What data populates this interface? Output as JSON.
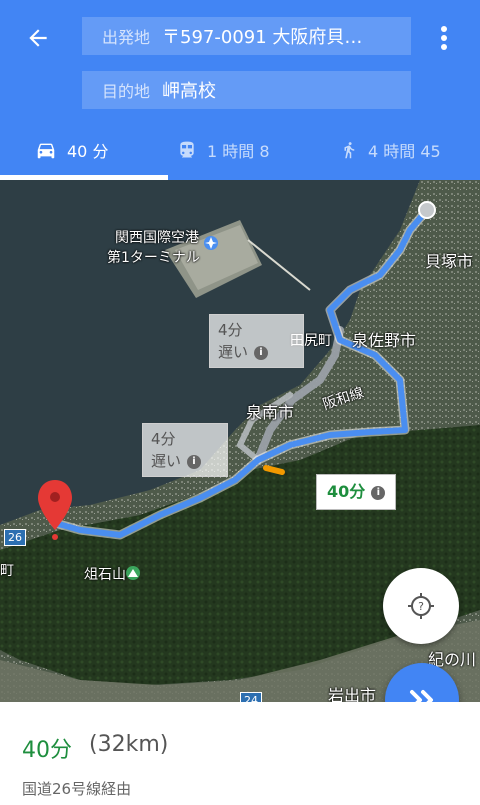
{
  "header": {
    "back_icon": "arrow-back-icon",
    "more_icon": "more-vert-icon",
    "origin": {
      "label": "出発地",
      "value": "〒597-0091 大阪府貝…"
    },
    "destination": {
      "label": "目的地",
      "value": "岬高校"
    },
    "colors": {
      "bar": "#4285f4",
      "text": "#ffffff"
    }
  },
  "tabs": [
    {
      "icon": "car-icon",
      "label": "40 分",
      "active": true
    },
    {
      "icon": "train-icon",
      "label": "1 時間 8",
      "active": false
    },
    {
      "icon": "walk-icon",
      "label": "4 時間 45",
      "active": false
    }
  ],
  "map": {
    "labels": {
      "airport_line1": "関西国際空港",
      "airport_line2": "第1ターミナル",
      "kaizuka": "貝塚市",
      "tajiri": "田尻町",
      "izumisano": "泉佐野市",
      "sennan": "泉南市",
      "hanwa": "阪和線",
      "sosekiyama": "俎石山",
      "kinokawa": "紀の川",
      "iwade": "岩出市",
      "machi": "町",
      "route26": "26",
      "route24": "24"
    },
    "callouts": {
      "alt1_time": "4分",
      "alt1_note": "遅い",
      "alt2_time": "4分",
      "alt2_note": "遅い",
      "main_time": "40分"
    },
    "route_color": "#4a8ef0"
  },
  "buttons": {
    "locate_icon": "my-location-icon",
    "start_icon": "navigation-start-icon"
  },
  "summary": {
    "time": "40分",
    "distance": "(32km)",
    "via": "国道26号線経由"
  }
}
